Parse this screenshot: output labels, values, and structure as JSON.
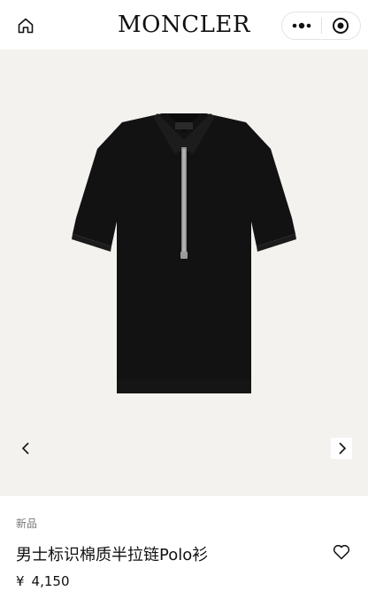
{
  "header": {
    "brand": "MONCLER",
    "home_icon": "home-icon",
    "more_icon": "more-dots-icon",
    "close_icon": "target-close-icon"
  },
  "gallery": {
    "prev_icon": "chevron-left-icon",
    "next_icon": "chevron-right-icon",
    "background": "#f3f2ef"
  },
  "product": {
    "badge": "新品",
    "title": "男士标识棉质半拉链Polo衫",
    "currency": "¥",
    "price": "4,150",
    "favorite_icon": "heart-outline-icon",
    "shirt_color": "#121213"
  }
}
